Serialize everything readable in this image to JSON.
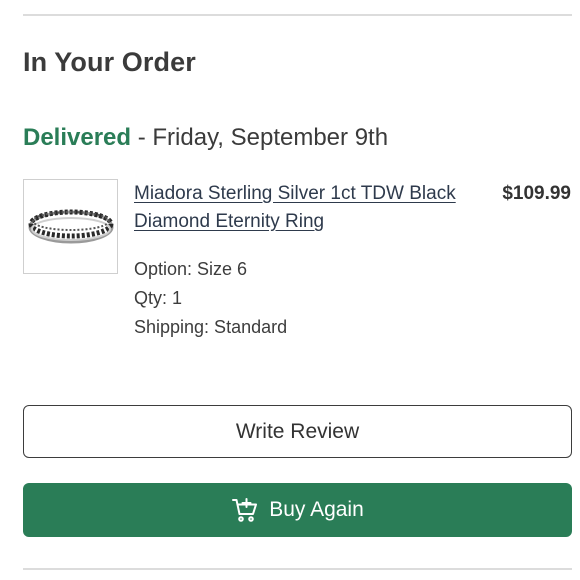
{
  "section": {
    "title": "In Your Order"
  },
  "status": {
    "label": "Delivered",
    "separator": " - ",
    "date": "Friday, September 9th",
    "color": "#2a7d57"
  },
  "item": {
    "name": "Miadora Sterling Silver 1ct TDW Black Diamond Eternity Ring",
    "price": "$109.99",
    "image_icon": "ring-image",
    "details": {
      "option": "Option: Size 6",
      "qty": "Qty: 1",
      "shipping": "Shipping: Standard"
    }
  },
  "actions": {
    "write_review": "Write Review",
    "buy_again": "Buy Again",
    "buy_again_icon": "cart-add-icon",
    "buy_again_color": "#2a7d57"
  }
}
